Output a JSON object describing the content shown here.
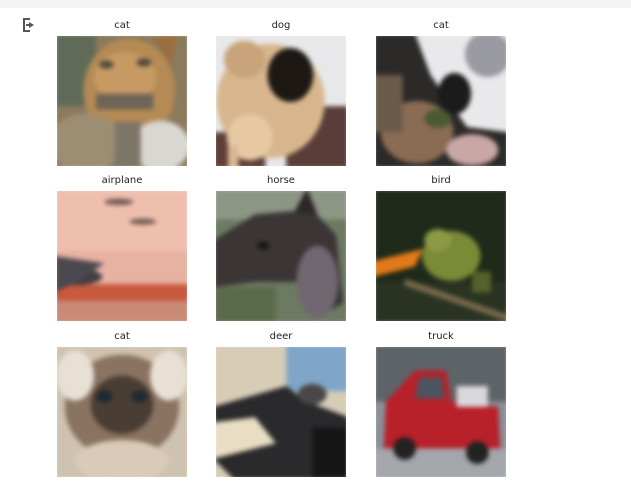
{
  "output": {
    "icon": "output-arrow-icon",
    "images": [
      {
        "label": "cat"
      },
      {
        "label": "dog"
      },
      {
        "label": "cat"
      },
      {
        "label": "airplane"
      },
      {
        "label": "horse"
      },
      {
        "label": "bird"
      },
      {
        "label": "cat"
      },
      {
        "label": "deer"
      },
      {
        "label": "truck"
      }
    ]
  }
}
